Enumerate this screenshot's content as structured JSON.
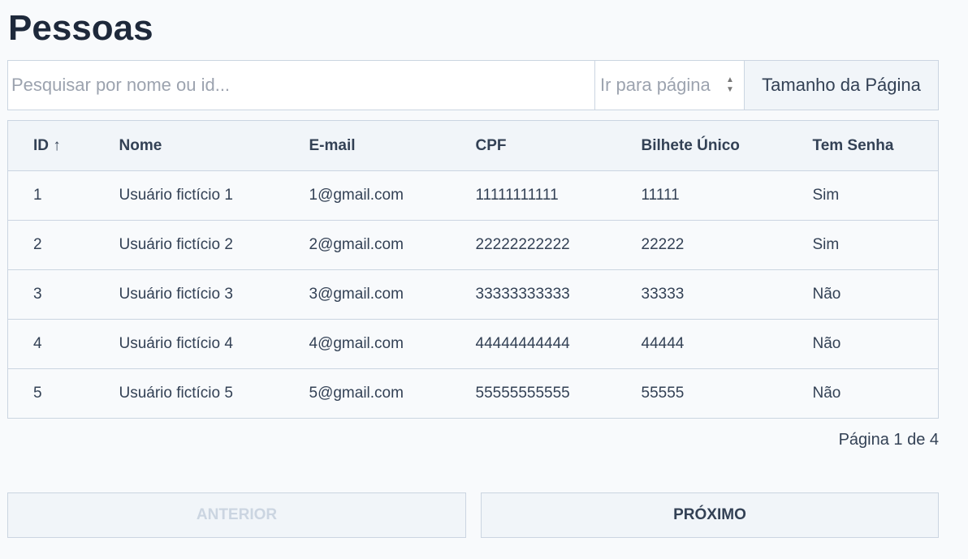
{
  "title": "Pessoas",
  "toolbar": {
    "search_placeholder": "Pesquisar por nome ou id...",
    "page_placeholder": "Ir para página",
    "page_size_label": "Tamanho da Página"
  },
  "table": {
    "headers": [
      "ID ↑",
      "Nome",
      "E-mail",
      "CPF",
      "Bilhete Único",
      "Tem Senha"
    ],
    "rows": [
      [
        "1",
        "Usuário fictício 1",
        "1@gmail.com",
        "11111111111",
        "11111",
        "Sim"
      ],
      [
        "2",
        "Usuário fictício 2",
        "2@gmail.com",
        "22222222222",
        "22222",
        "Sim"
      ],
      [
        "3",
        "Usuário fictício 3",
        "3@gmail.com",
        "33333333333",
        "33333",
        "Não"
      ],
      [
        "4",
        "Usuário fictício 4",
        "4@gmail.com",
        "44444444444",
        "44444",
        "Não"
      ],
      [
        "5",
        "Usuário fictício 5",
        "5@gmail.com",
        "55555555555",
        "55555",
        "Não"
      ]
    ]
  },
  "pagination": {
    "info": "Página 1 de 4",
    "prev_label": "ANTERIOR",
    "next_label": "PRÓXIMO",
    "prev_disabled": true
  }
}
